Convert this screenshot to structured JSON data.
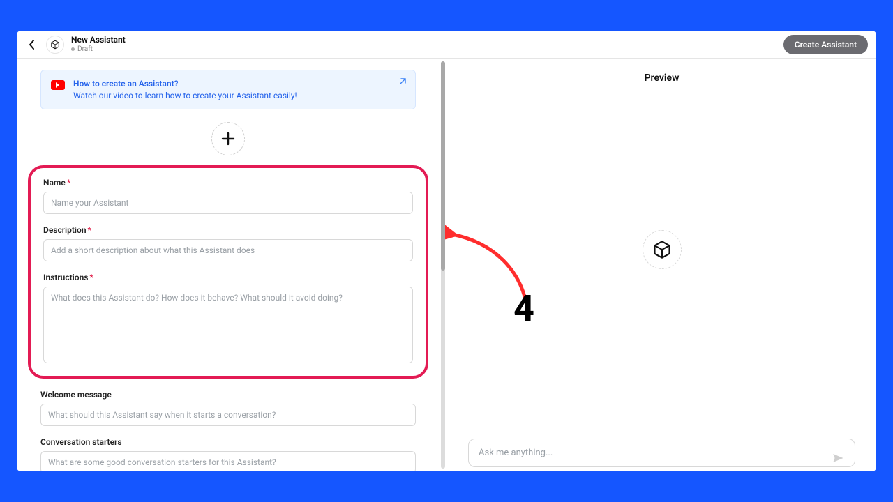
{
  "header": {
    "title": "New Assistant",
    "status": "Draft",
    "create_button": "Create Assistant"
  },
  "banner": {
    "link_text": "How to create an Assistant?",
    "subtitle": "Watch our video to learn how to create your Assistant easily!"
  },
  "form": {
    "name": {
      "label": "Name",
      "placeholder": "Name your Assistant"
    },
    "description": {
      "label": "Description",
      "placeholder": "Add a short description about what this Assistant does"
    },
    "instructions": {
      "label": "Instructions",
      "placeholder": "What does this Assistant do? How does it behave? What should it avoid doing?"
    },
    "welcome": {
      "label": "Welcome message",
      "placeholder": "What should this Assistant say when it starts a conversation?"
    },
    "starters": {
      "label": "Conversation starters",
      "placeholder": "What are some good conversation starters for this Assistant?"
    }
  },
  "preview": {
    "title": "Preview",
    "input_placeholder": "Ask me anything..."
  },
  "annotation": {
    "number": "4"
  },
  "colors": {
    "accent_blue": "#1556ff",
    "highlight": "#e31b54"
  }
}
